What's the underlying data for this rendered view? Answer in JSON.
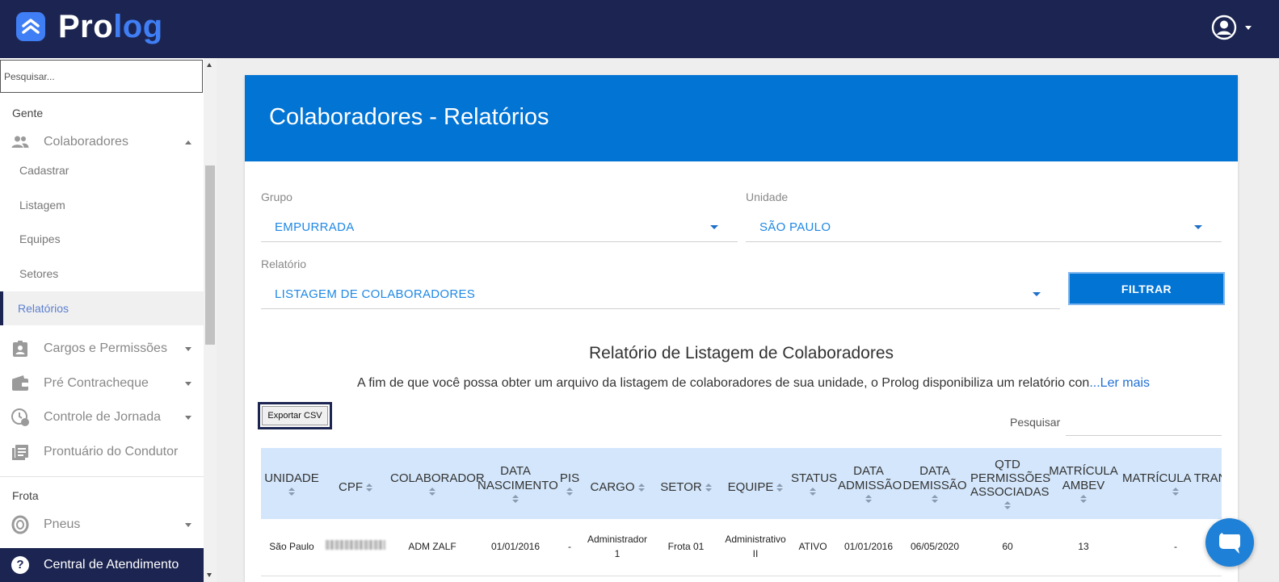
{
  "app": {
    "logo_pro": "Pro",
    "logo_log": "log"
  },
  "sidebar": {
    "search_placeholder": "Pesquisar...",
    "section_gente": "Gente",
    "section_frota": "Frota",
    "colaboradores_label": "Colaboradores",
    "sub_items": [
      "Cadastrar",
      "Listagem",
      "Equipes",
      "Setores",
      "Relatórios"
    ],
    "cargos_label": "Cargos e Permissões",
    "contracheque_label": "Pré Contracheque",
    "jornada_label": "Controle de Jornada",
    "prontuario_label": "Prontuário do Condutor",
    "pneus_label": "Pneus",
    "help_label": "Central de Atendimento"
  },
  "page": {
    "title": "Colaboradores - Relatórios",
    "grupo_label": "Grupo",
    "grupo_value": "EMPURRADA",
    "unidade_label": "Unidade",
    "unidade_value": "SÃO PAULO",
    "relatorio_label": "Relatório",
    "relatorio_value": "LISTAGEM DE COLABORADORES",
    "filtrar_label": "FILTRAR",
    "report_title": "Relatório de Listagem de Colaboradores",
    "report_desc": "A fim de que você possa obter um arquivo da listagem de colaboradores de sua unidade, o Prolog disponibiliza um relatório con",
    "report_more": "...Ler mais",
    "export_label": "Exportar CSV",
    "search_label": "Pesquisar"
  },
  "table": {
    "headers": [
      "UNIDADE",
      "CPF",
      "COLABORADOR",
      "DATA NASCIMENTO",
      "PIS",
      "CARGO",
      "SETOR",
      "EQUIPE",
      "STATUS",
      "DATA ADMISSÃO",
      "DATA DEMISSÃO",
      "QTD PERMISSÕES ASSOCIADAS",
      "MATRÍCULA AMBEV",
      "MATRÍCULA TRANSPORTADORA"
    ],
    "rows": [
      [
        "São Paulo",
        "",
        "ADM ZALF",
        "01/01/2016",
        "-",
        "Administrador 1",
        "Frota 01",
        "Administrativo II",
        "ATIVO",
        "01/01/2016",
        "06/05/2020",
        "60",
        "13",
        "-"
      ]
    ]
  },
  "colors": {
    "topbar": "#1c2551",
    "header": "#0274d4",
    "accent": "#1e88e5",
    "table_head": "#d3e6fb"
  }
}
